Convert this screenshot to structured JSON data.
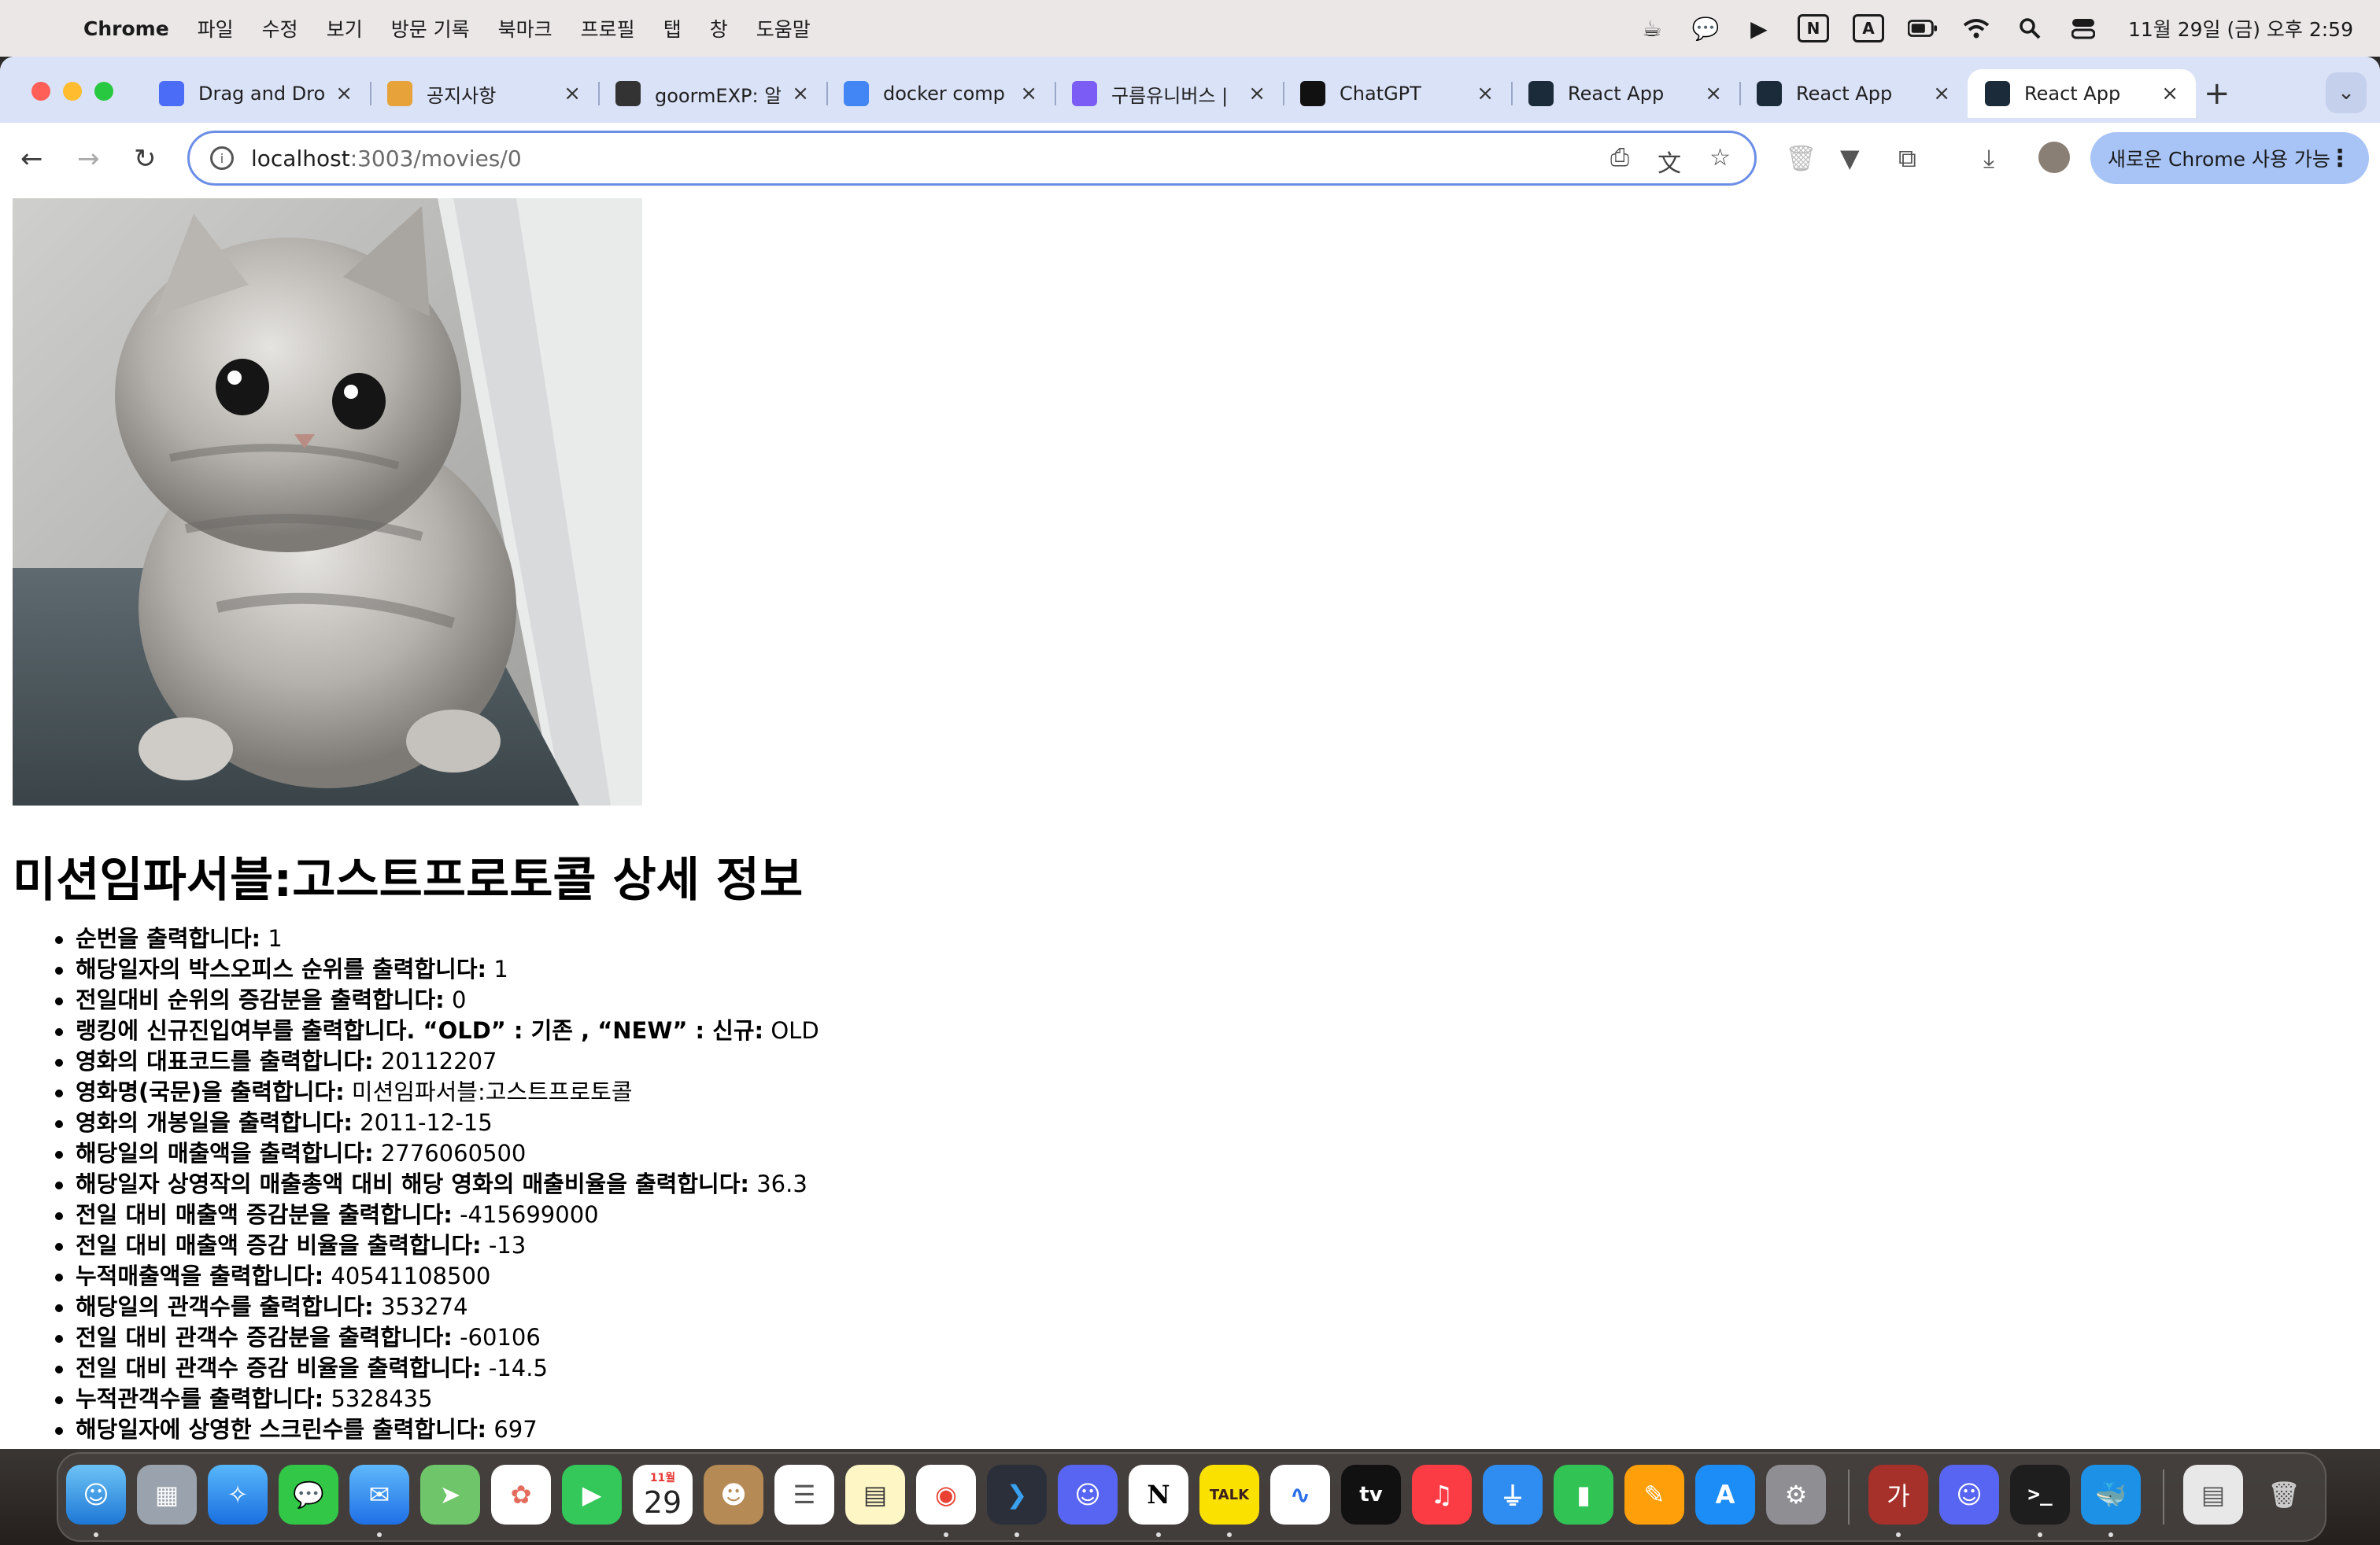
{
  "menubar": {
    "app_name": "Chrome",
    "items": [
      "파일",
      "수정",
      "보기",
      "방문 기록",
      "북마크",
      "프로필",
      "탭",
      "창",
      "도움말"
    ],
    "clock": "11월 29일 (금) 오후 2:59",
    "status_boxed_1": "N",
    "status_boxed_2": "A"
  },
  "tabs": [
    {
      "title": "Drag and Dro",
      "icon": "drag-drop-favicon-icon",
      "color": "#4a6cf7",
      "active": false
    },
    {
      "title": "공지사항",
      "icon": "notice-favicon-icon",
      "color": "#e8a23a",
      "active": false
    },
    {
      "title": "goormEXP: 알",
      "icon": "goorm-favicon-icon",
      "color": "#333333",
      "active": false
    },
    {
      "title": "docker comp",
      "icon": "google-favicon-icon",
      "color": "#4285f4",
      "active": false
    },
    {
      "title": "구름유니버스 |",
      "icon": "universe-favicon-icon",
      "color": "#7b5cf5",
      "active": false
    },
    {
      "title": "ChatGPT",
      "icon": "chatgpt-favicon-icon",
      "color": "#111111",
      "active": false
    },
    {
      "title": "React App",
      "icon": "react-favicon-icon",
      "color": "#1b2b3a",
      "active": false
    },
    {
      "title": "React App",
      "icon": "react-favicon-icon",
      "color": "#1b2b3a",
      "active": false
    },
    {
      "title": "React App",
      "icon": "react-favicon-icon",
      "color": "#1b2b3a",
      "active": true
    }
  ],
  "omnibox": {
    "host": "localhost",
    "rest": ":3003/movies/0"
  },
  "update_button": "새로운 Chrome 사용 가능",
  "movie": {
    "title": "미션임파서블:고스트프로토콜 상세 정보",
    "poster_alt": "cat photo",
    "fields": [
      {
        "label": "순번을 출력합니다:",
        "value": " 1"
      },
      {
        "label": "해당일자의 박스오피스 순위를 출력합니다:",
        "value": " 1"
      },
      {
        "label": "전일대비 순위의 증감분을 출력합니다:",
        "value": " 0"
      },
      {
        "label": "랭킹에 신규진입여부를 출력합니다. “OLD” : 기존 , “NEW” : 신규:",
        "value": " OLD"
      },
      {
        "label": "영화의 대표코드를 출력합니다:",
        "value": " 20112207"
      },
      {
        "label": "영화명(국문)을 출력합니다:",
        "value": " 미션임파서블:고스트프로토콜"
      },
      {
        "label": "영화의 개봉일을 출력합니다:",
        "value": " 2011-12-15"
      },
      {
        "label": "해당일의 매출액을 출력합니다:",
        "value": " 2776060500"
      },
      {
        "label": "해당일자 상영작의 매출총액 대비 해당 영화의 매출비율을 출력합니다:",
        "value": " 36.3"
      },
      {
        "label": "전일 대비 매출액 증감분을 출력합니다:",
        "value": " -415699000"
      },
      {
        "label": "전일 대비 매출액 증감 비율을 출력합니다:",
        "value": " -13"
      },
      {
        "label": "누적매출액을 출력합니다:",
        "value": " 40541108500"
      },
      {
        "label": "해당일의 관객수를 출력합니다:",
        "value": " 353274"
      },
      {
        "label": "전일 대비 관객수 증감분을 출력합니다:",
        "value": " -60106"
      },
      {
        "label": "전일 대비 관객수 증감 비율을 출력합니다:",
        "value": " -14.5"
      },
      {
        "label": "누적관객수를 출력합니다:",
        "value": " 5328435"
      },
      {
        "label": "해당일자에 상영한 스크린수를 출력합니다:",
        "value": " 697"
      }
    ]
  },
  "dock": {
    "calendar_month": "11월",
    "calendar_day": "29",
    "kakao_label": "TALK",
    "tv_label": "tv",
    "korean_input_label": "가",
    "terminal_label": ">_"
  }
}
